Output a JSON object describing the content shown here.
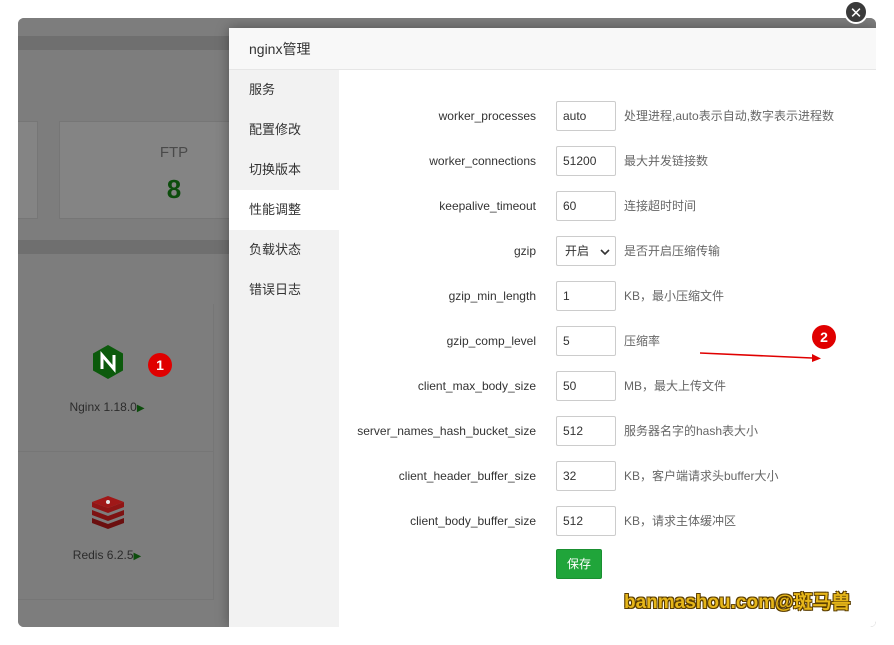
{
  "modal": {
    "title": "nginx管理"
  },
  "close": {
    "glyph": "✕"
  },
  "sidebar": {
    "items": [
      {
        "label": "服务"
      },
      {
        "label": "配置修改"
      },
      {
        "label": "切换版本"
      },
      {
        "label": "性能调整"
      },
      {
        "label": "负载状态"
      },
      {
        "label": "错误日志"
      }
    ],
    "active": "性能调整"
  },
  "settings": [
    {
      "key": "worker_processes",
      "value": "auto",
      "desc": "处理进程,auto表示自动,数字表示进程数"
    },
    {
      "key": "worker_connections",
      "value": "51200",
      "desc": "最大并发链接数"
    },
    {
      "key": "keepalive_timeout",
      "value": "60",
      "desc": "连接超时时间"
    },
    {
      "key": "gzip",
      "value": "开启",
      "desc": "是否开启压缩传输",
      "type": "select"
    },
    {
      "key": "gzip_min_length",
      "value": "1",
      "desc": "KB，最小压缩文件"
    },
    {
      "key": "gzip_comp_level",
      "value": "5",
      "desc": "压缩率"
    },
    {
      "key": "client_max_body_size",
      "value": "50",
      "desc": "MB，最大上传文件"
    },
    {
      "key": "server_names_hash_bucket_size",
      "value": "512",
      "desc": "服务器名字的hash表大小"
    },
    {
      "key": "client_header_buffer_size",
      "value": "32",
      "desc": "KB，客户端请求头buffer大小"
    },
    {
      "key": "client_body_buffer_size",
      "value": "512",
      "desc": "KB，请求主体缓冲区"
    }
  ],
  "save": {
    "label": "保存"
  },
  "background": {
    "ftp": {
      "title": "FTP",
      "count": "8"
    },
    "nginx": {
      "label": "Nginx 1.18.0"
    },
    "redis": {
      "label": "Redis 6.2.5"
    }
  },
  "annotations": {
    "marker1": "1",
    "marker2": "2"
  },
  "watermark": {
    "text": "banmashou.com@斑马兽"
  },
  "colors": {
    "accent": "#20a53a",
    "marker": "#e00000",
    "watermark": "#e6b619"
  }
}
